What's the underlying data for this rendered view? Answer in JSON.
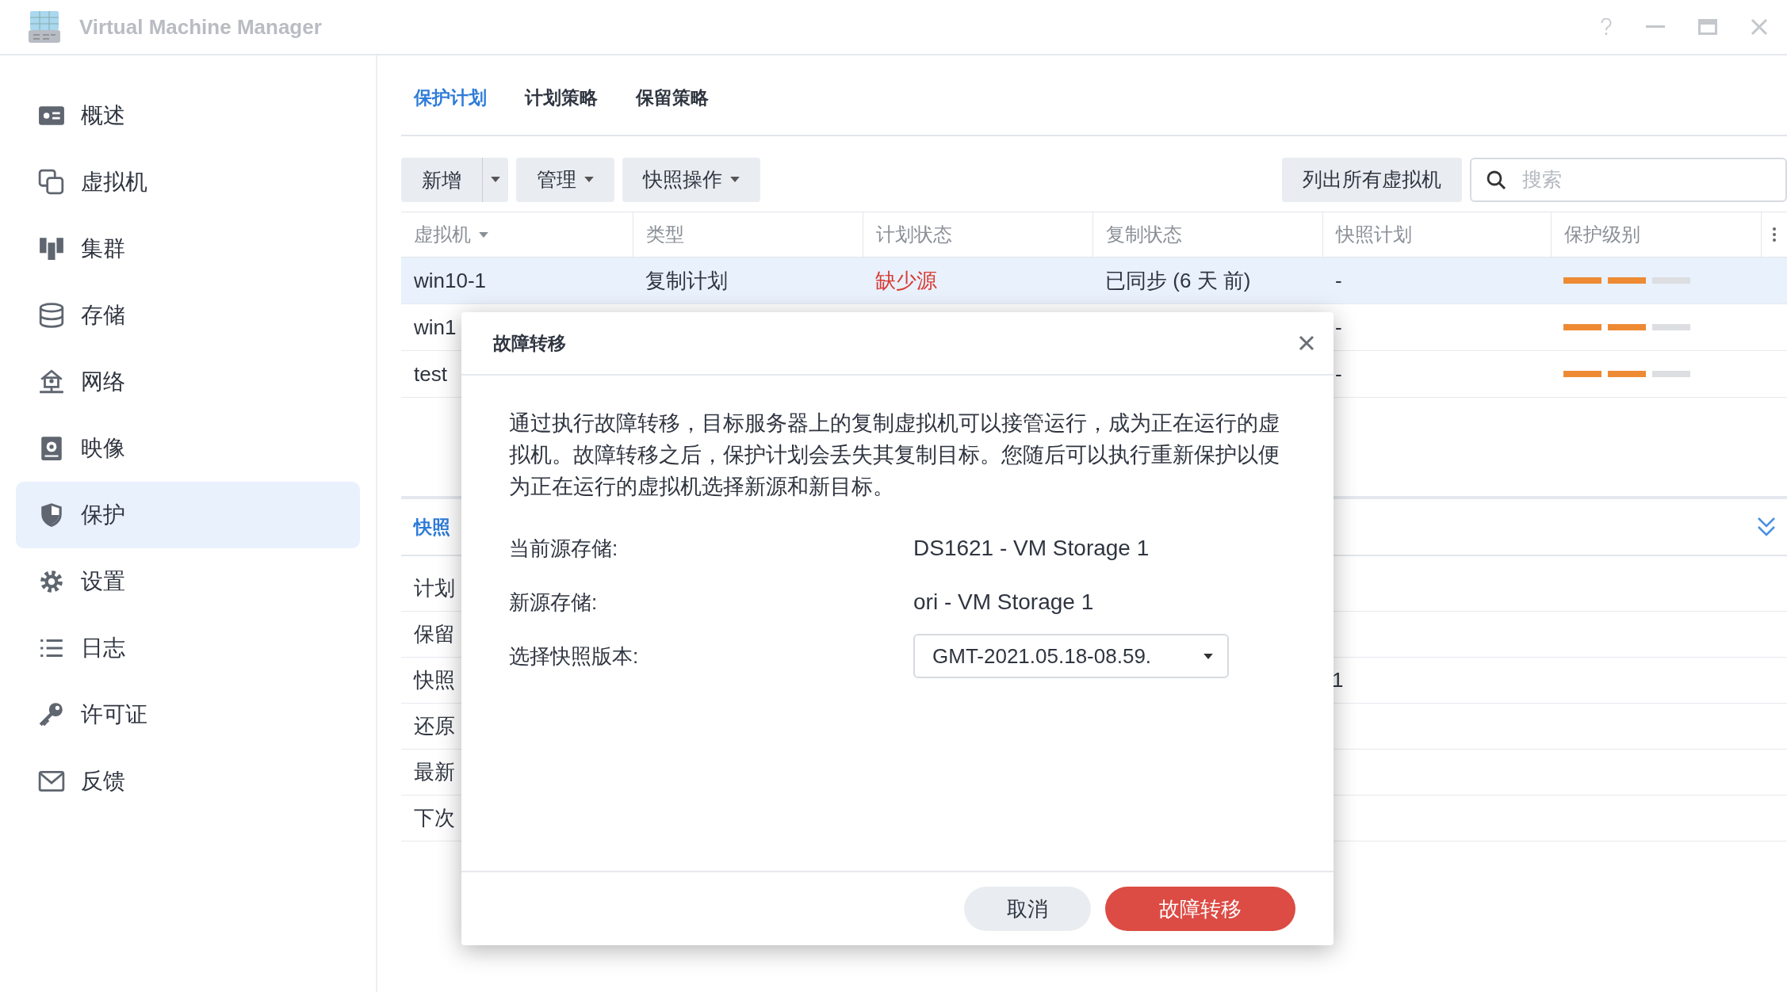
{
  "window": {
    "title": "Virtual Machine Manager"
  },
  "sidebar": {
    "items": [
      {
        "label": "概述",
        "selected": false
      },
      {
        "label": "虚拟机",
        "selected": false
      },
      {
        "label": "集群",
        "selected": false
      },
      {
        "label": "存储",
        "selected": false
      },
      {
        "label": "网络",
        "selected": false
      },
      {
        "label": "映像",
        "selected": false
      },
      {
        "label": "保护",
        "selected": true
      },
      {
        "label": "设置",
        "selected": false
      },
      {
        "label": "日志",
        "selected": false
      },
      {
        "label": "许可证",
        "selected": false
      },
      {
        "label": "反馈",
        "selected": false
      }
    ]
  },
  "tabs": [
    {
      "label": "保护计划",
      "selected": true
    },
    {
      "label": "计划策略",
      "selected": false
    },
    {
      "label": "保留策略",
      "selected": false
    }
  ],
  "toolbar": {
    "create": "新增",
    "manage": "管理",
    "snapshot_actions": "快照操作",
    "list_all": "列出所有虚拟机",
    "search": {
      "placeholder": "搜索"
    }
  },
  "table": {
    "columns": [
      {
        "label": "虚拟机",
        "sorted": true
      },
      {
        "label": "类型",
        "sorted": false
      },
      {
        "label": "计划状态",
        "sorted": false
      },
      {
        "label": "复制状态",
        "sorted": false
      },
      {
        "label": "快照计划",
        "sorted": false
      },
      {
        "label": "保护级别",
        "sorted": false
      }
    ],
    "rows": [
      {
        "vm": "win10-1",
        "type": "复制计划",
        "plan_status": {
          "text": "缺少源",
          "kind": "error"
        },
        "replication": "已同步 (6 天 前)",
        "snapshot_plan": "-",
        "level": 0.67,
        "selected": true
      },
      {
        "vm": "win1",
        "snapshot_plan": "-",
        "level": 0.67,
        "selected": false
      },
      {
        "vm": "test",
        "snapshot_plan": "-",
        "level": 0.67,
        "selected": false
      }
    ]
  },
  "details": {
    "tab": "快照",
    "rows": [
      {
        "label": "计划"
      },
      {
        "label": "保留"
      },
      {
        "label": "快照",
        "value": "1"
      },
      {
        "label": "还原"
      },
      {
        "label": "最新"
      },
      {
        "label": "下次"
      }
    ]
  },
  "dialog": {
    "title": "故障转移",
    "message": "通过执行故障转移，目标服务器上的复制虚拟机可以接管运行，成为正在运行的虚拟机。故障转移之后，保护计划会丢失其复制目标。您随后可以执行重新保护以便为正在运行的虚拟机选择新源和新目标。",
    "fields": [
      {
        "label": "当前源存储:",
        "kind": "text",
        "value": "DS1621 - VM Storage 1"
      },
      {
        "label": "新源存储:",
        "kind": "text",
        "value": "ori - VM Storage 1"
      },
      {
        "label": "选择快照版本:",
        "kind": "select",
        "value": "GMT-2021.05.18-08.59."
      }
    ],
    "buttons": [
      {
        "label": "取消",
        "kind": "secondary"
      },
      {
        "label": "故障转移",
        "kind": "primary"
      }
    ]
  }
}
